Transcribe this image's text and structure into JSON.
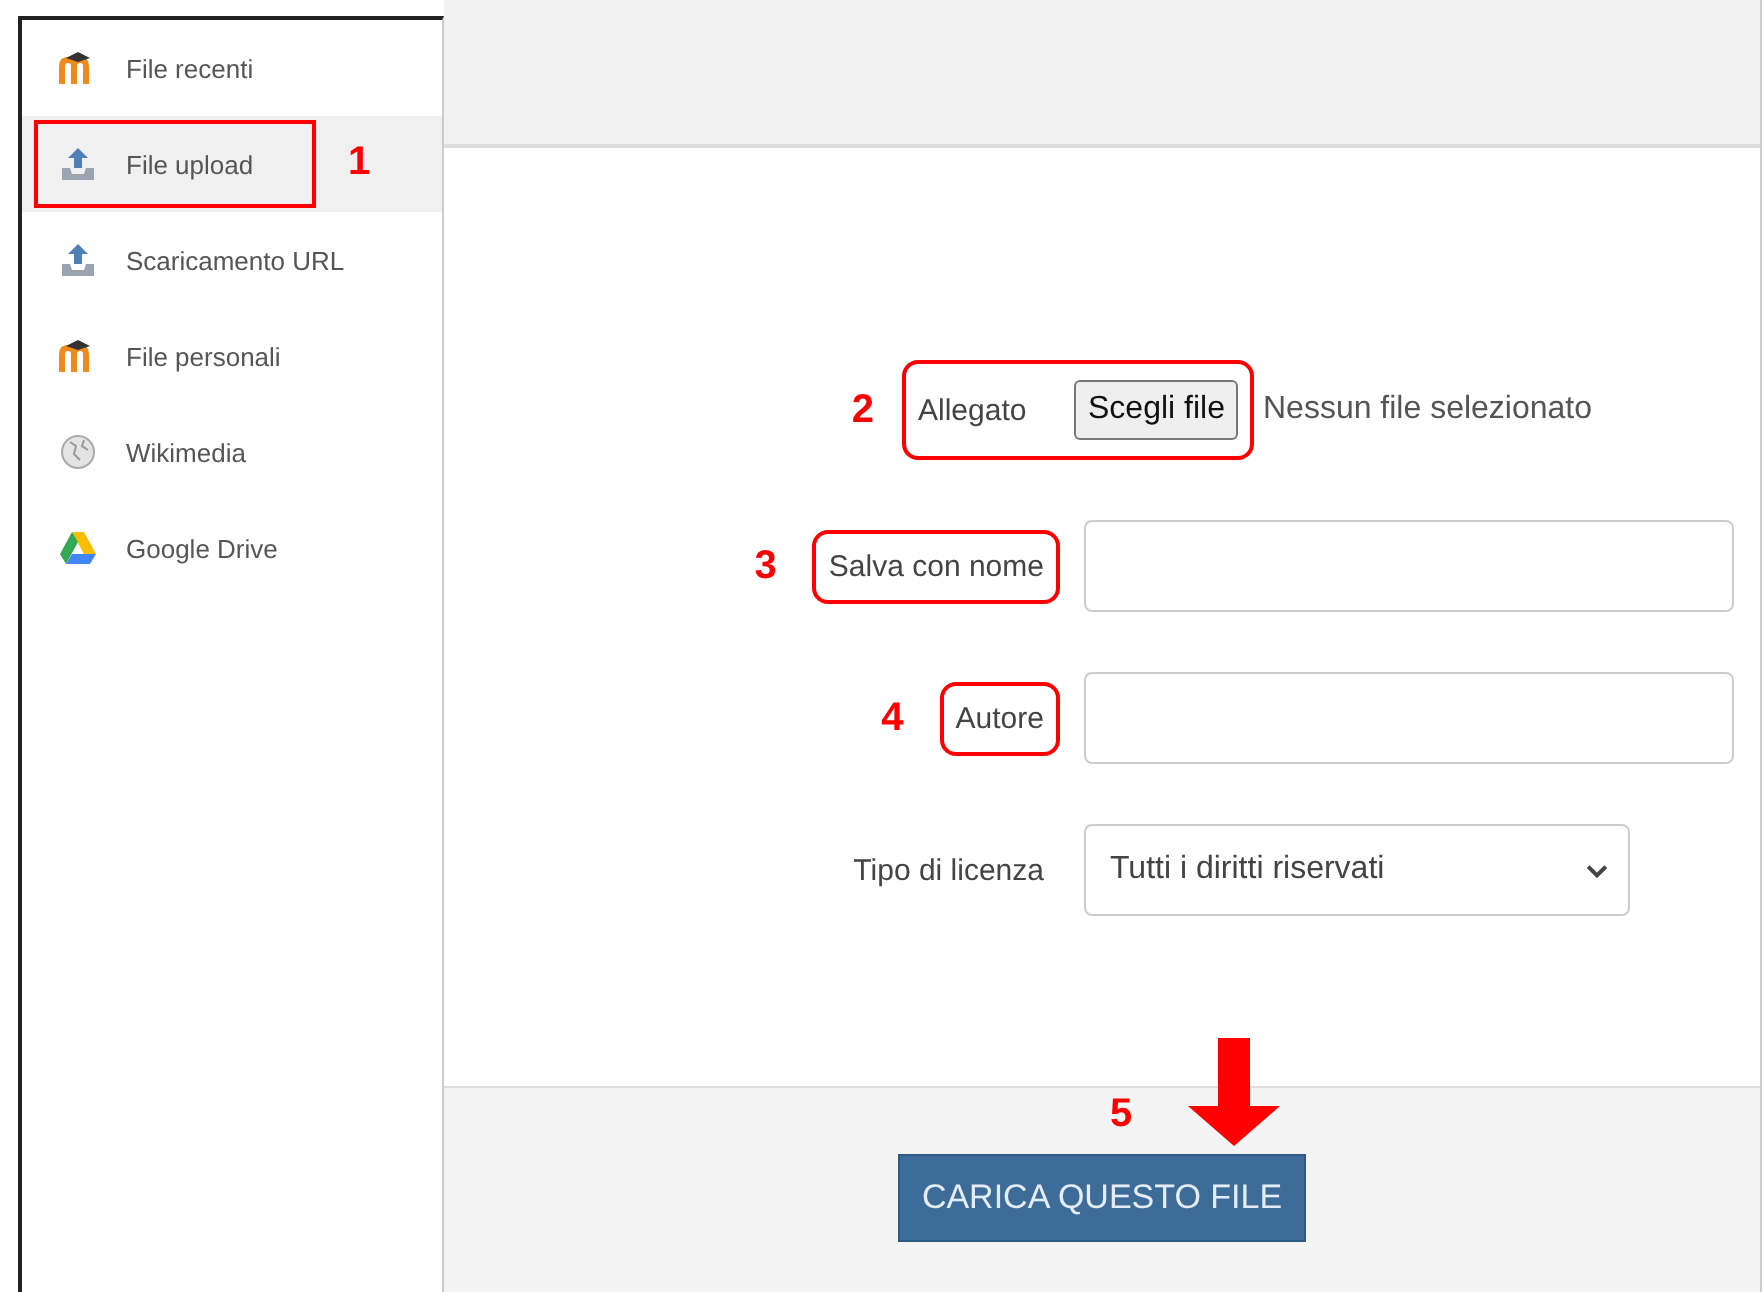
{
  "sidebar": {
    "items": [
      {
        "label": "File recenti",
        "kind": "moodle",
        "selected": false,
        "outlined": false
      },
      {
        "label": "File upload",
        "kind": "upload",
        "selected": true,
        "outlined": true,
        "marker": "1"
      },
      {
        "label": "Scaricamento URL",
        "kind": "upload",
        "selected": false,
        "outlined": false
      },
      {
        "label": "File personali",
        "kind": "moodle",
        "selected": false,
        "outlined": false
      },
      {
        "label": "Wikimedia",
        "kind": "globe",
        "selected": false,
        "outlined": false
      },
      {
        "label": "Google Drive",
        "kind": "drive",
        "selected": false,
        "outlined": false
      }
    ]
  },
  "form": {
    "fields": [
      {
        "kind": "file",
        "label": "Allegato",
        "button": "Scegli file",
        "status": "Nessun file selezionato",
        "outlined": true,
        "marker": "2"
      },
      {
        "kind": "text",
        "label": "Salva con nome",
        "outlined": true,
        "marker": "3"
      },
      {
        "kind": "text",
        "label": "Autore",
        "outlined": true,
        "marker": "4"
      },
      {
        "kind": "select",
        "label": "Tipo di licenza",
        "value": "Tutti i diritti riservati",
        "outlined": false
      }
    ]
  },
  "footer": {
    "button": "CARICA QUESTO FILE",
    "marker": "5",
    "arrow": true
  }
}
